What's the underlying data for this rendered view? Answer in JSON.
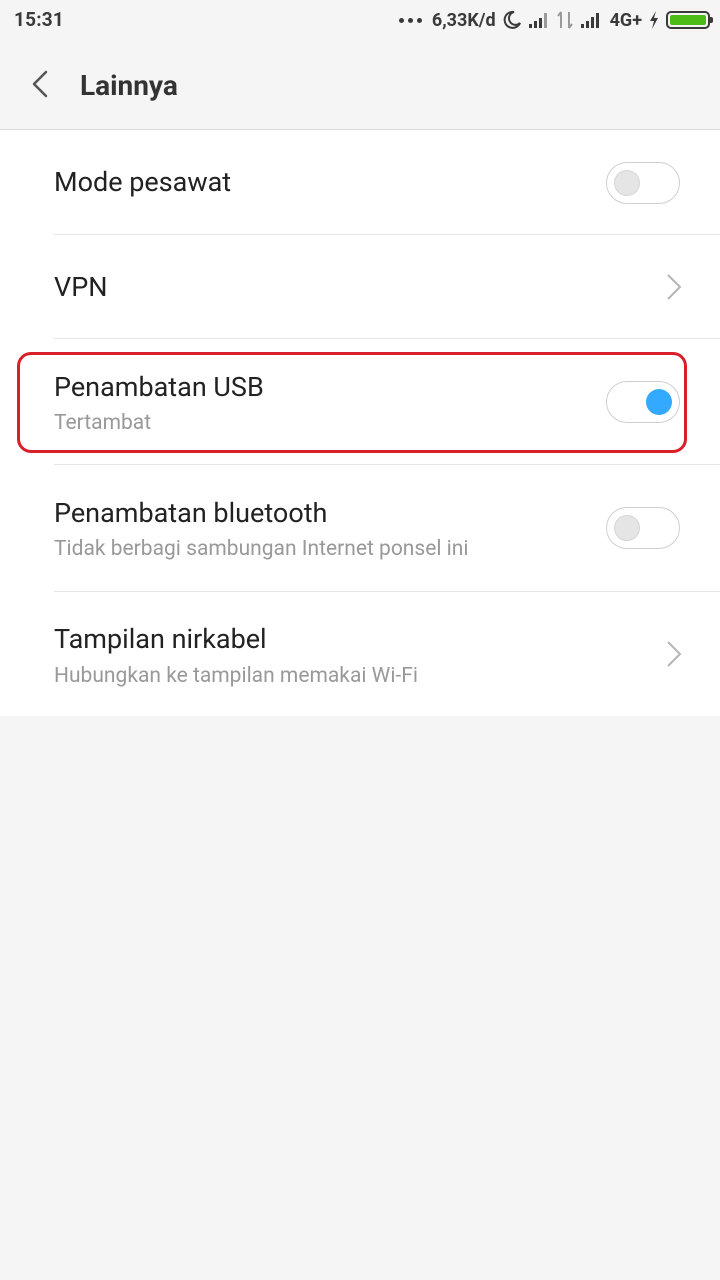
{
  "status_bar": {
    "time": "15:31",
    "speed": "6,33K/d",
    "network": "4G+"
  },
  "header": {
    "title": "Lainnya"
  },
  "items": [
    {
      "title": "Mode pesawat",
      "subtitle": "",
      "control": "toggle",
      "enabled": false
    },
    {
      "title": "VPN",
      "subtitle": "",
      "control": "chevron"
    },
    {
      "title": "Penambatan USB",
      "subtitle": "Tertambat",
      "control": "toggle",
      "enabled": true
    },
    {
      "title": "Penambatan bluetooth",
      "subtitle": "Tidak berbagi sambungan Internet ponsel ini",
      "control": "toggle",
      "enabled": false
    },
    {
      "title": "Tampilan nirkabel",
      "subtitle": "Hubungkan ke tampilan memakai Wi-Fi",
      "control": "chevron"
    }
  ],
  "colors": {
    "accent": "#33aaff",
    "highlight": "#d9202a",
    "battery": "#4cbb17"
  },
  "icons": [
    "back-chevron-icon",
    "moon-icon",
    "signal-icon",
    "data-arrows-icon",
    "charging-bolt-icon",
    "battery-icon",
    "chevron-right-icon"
  ]
}
